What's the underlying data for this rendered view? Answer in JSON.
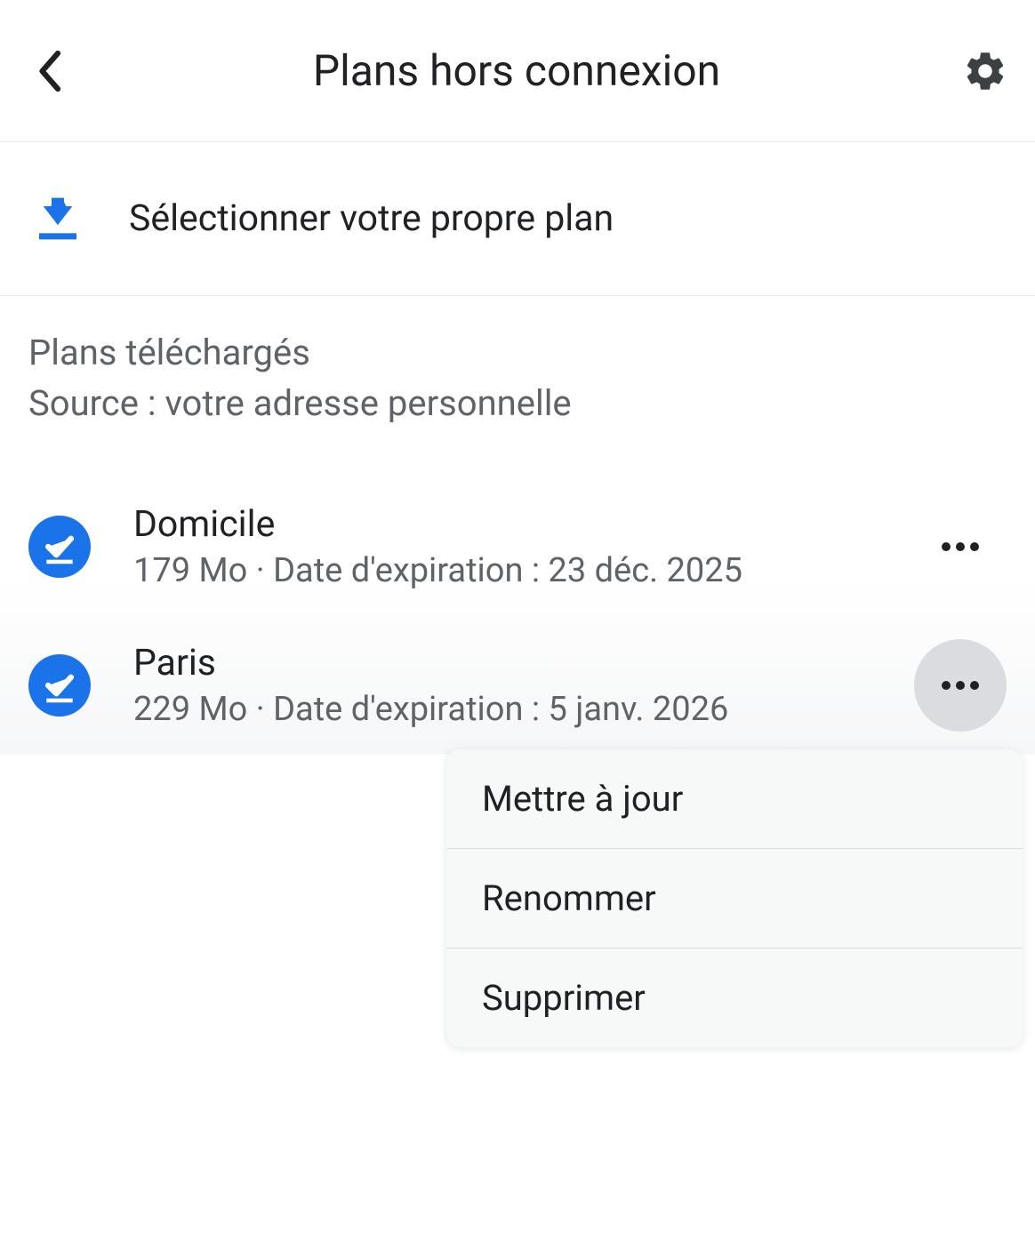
{
  "header": {
    "title": "Plans hors connexion"
  },
  "selectPlan": {
    "label": "Sélectionner votre propre plan"
  },
  "section": {
    "title": "Plans téléchargés",
    "subtitle": "Source : votre adresse personnelle"
  },
  "plans": [
    {
      "name": "Domicile",
      "details": "179 Mo  ·  Date d'expiration : 23 déc. 2025"
    },
    {
      "name": "Paris",
      "details": "229 Mo  ·  Date d'expiration : 5 janv. 2026"
    }
  ],
  "menu": {
    "update": "Mettre à jour",
    "rename": "Renommer",
    "delete": "Supprimer"
  }
}
